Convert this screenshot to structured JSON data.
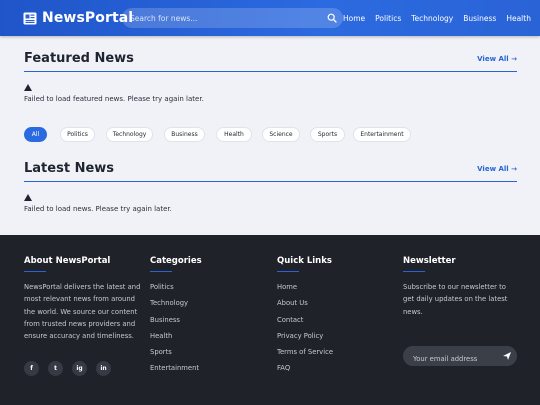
{
  "header": {
    "logo_text": "NewsPortal",
    "search_placeholder": "Search for news...",
    "nav": [
      "Home",
      "Politics",
      "Technology",
      "Business",
      "Health"
    ]
  },
  "featured": {
    "title": "Featured News",
    "view_all": "View All →",
    "error": "Failed to load featured news. Please try again later."
  },
  "filters": {
    "items": [
      "All",
      "Politics",
      "Technology",
      "Business",
      "Health",
      "Science",
      "Sports",
      "Entertainment"
    ],
    "active": "All"
  },
  "latest": {
    "title": "Latest News",
    "view_all": "View All →",
    "error": "Failed to load news. Please try again later."
  },
  "footer": {
    "about": {
      "title": "About NewsPortal",
      "text": "NewsPortal delivers the latest and most relevant news from around the world. We source our content from trusted news providers and ensure accuracy and timeliness."
    },
    "socials": [
      "f",
      "t",
      "ig",
      "in"
    ],
    "categories": {
      "title": "Categories",
      "items": [
        "Politics",
        "Technology",
        "Business",
        "Health",
        "Sports",
        "Entertainment"
      ]
    },
    "quick_links": {
      "title": "Quick Links",
      "items": [
        "Home",
        "About Us",
        "Contact",
        "Privacy Policy",
        "Terms of Service",
        "FAQ"
      ]
    },
    "newsletter": {
      "title": "Newsletter",
      "text": "Subscribe to our newsletter to get daily updates on the latest news.",
      "placeholder": "Your email address"
    }
  },
  "colors": {
    "header_blue": "#2a63d6",
    "accent": "#2a6ae0",
    "footer_bg": "#202229",
    "page_bg": "#f0f2f7"
  }
}
